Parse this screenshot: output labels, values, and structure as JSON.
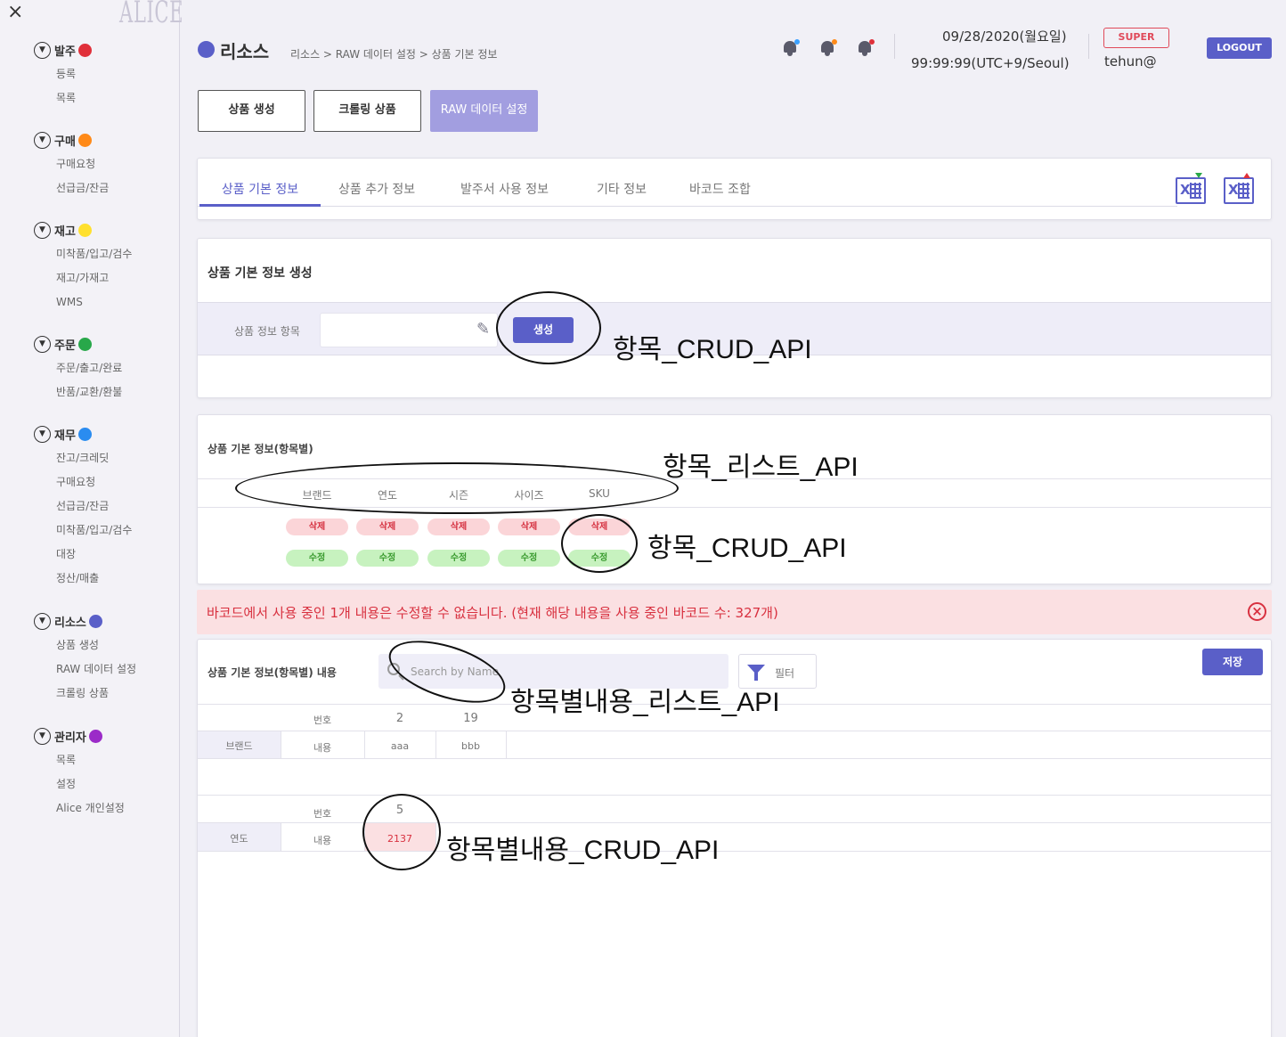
{
  "sidebar": {
    "close_icon": "×",
    "logo": "ALICE",
    "groups": [
      {
        "title": "발주",
        "color": "#e0303a",
        "items": [
          "등록",
          "목록"
        ]
      },
      {
        "title": "구매",
        "color": "#ff8a18",
        "items": [
          "구매요청",
          "선급금/잔금"
        ]
      },
      {
        "title": "재고",
        "color": "#ffe02e",
        "items": [
          "미착품/입고/검수",
          "재고/가재고",
          "WMS"
        ]
      },
      {
        "title": "주문",
        "color": "#28a84a",
        "items": [
          "주문/출고/완료",
          "반품/교환/환불"
        ]
      },
      {
        "title": "재무",
        "color": "#2a8cf0",
        "items": [
          "잔고/크레딧",
          "구매요청",
          "선급금/잔금",
          "미착품/입고/검수",
          "대장",
          "정산/매출"
        ]
      },
      {
        "title": "리소스",
        "color": "#5a5fc8",
        "items": [
          "상품 생성",
          "RAW 데이터 설정",
          "크롤링 상품"
        ]
      },
      {
        "title": "관리자",
        "color": "#9b2bc8",
        "items": [
          "목록",
          "설정",
          "Alice 개인설정"
        ]
      }
    ]
  },
  "header": {
    "title": "리소스",
    "accent_color": "#5a5fc8",
    "breadcrumb": "리소스 > RAW 데이터 설정 > 상품 기본 정보",
    "date": "09/28/2020(월요일)",
    "time": "99:99:99(UTC+9/Seoul)",
    "role_badge": "SUPER",
    "user": "tehun@",
    "logout": "LOGOUT"
  },
  "top_buttons": [
    "상품 생성",
    "크롤링 상품",
    "RAW 데이터 설정"
  ],
  "tabs": [
    "상품 기본 정보",
    "상품 추가 정보",
    "발주서 사용 정보",
    "기타 정보",
    "바코드 조합"
  ],
  "create": {
    "title": "상품 기본 정보 생성",
    "field_label": "상품 정보 항목",
    "input_value": "",
    "button": "생성"
  },
  "item_list": {
    "title": "상품 기본 정보(항목별)",
    "columns": [
      "브랜드",
      "연도",
      "시즌",
      "사이즈",
      "SKU"
    ],
    "delete_label": "삭제",
    "edit_label": "수정"
  },
  "alert": {
    "message": "바코드에서 사용 중인 1개 내용은 수정할 수 없습니다. (현재 해당 내용을 사용 중인 바코드 수: 327개)"
  },
  "content": {
    "title": "상품 기본 정보(항목별) 내용",
    "search_placeholder": "Search by Name",
    "filter": "필터",
    "save": "저장",
    "groups": [
      {
        "name": "브랜드",
        "num_label": "번호",
        "content_label": "내용",
        "entries": [
          {
            "num": "2",
            "value": "aaa"
          },
          {
            "num": "19",
            "value": "bbb"
          }
        ]
      },
      {
        "name": "연도",
        "num_label": "번호",
        "content_label": "내용",
        "entries": [
          {
            "num": "5",
            "value": "2137"
          }
        ]
      }
    ]
  },
  "annotations": [
    "항목_CRUD_API",
    "항목_리스트_API",
    "항목_CRUD_API",
    "항목별내용_리스트_API",
    "항목별내용_CRUD_API"
  ]
}
